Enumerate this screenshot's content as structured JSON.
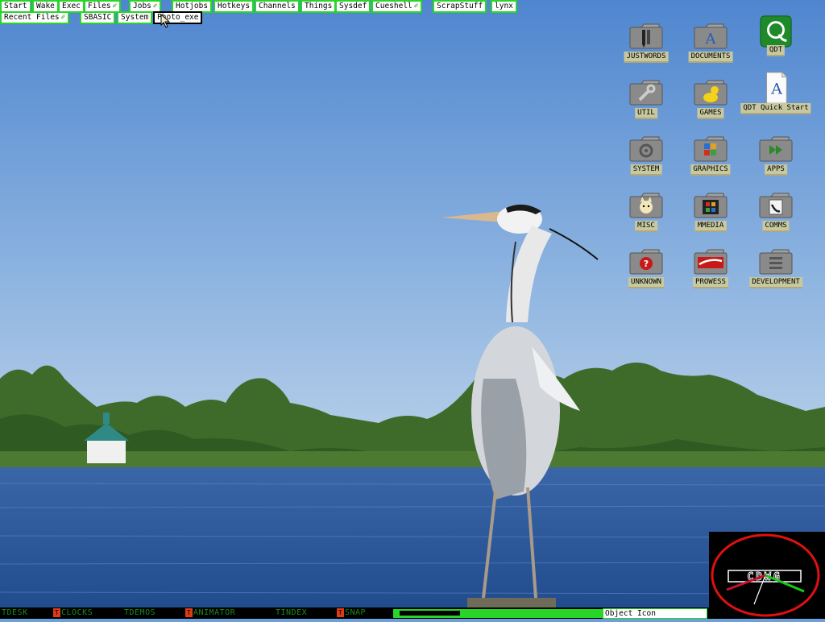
{
  "menu": {
    "row1": [
      {
        "label": "Start",
        "has_sub": false
      },
      {
        "label": "Wake",
        "has_sub": false
      },
      {
        "label": "Exec",
        "has_sub": false
      },
      {
        "label": "Files",
        "has_sub": true
      },
      {
        "label": "Jobs",
        "has_sub": true
      },
      {
        "label": "Hotjobs",
        "has_sub": false
      },
      {
        "label": "Hotkeys",
        "has_sub": false
      },
      {
        "label": "Channels",
        "has_sub": false
      },
      {
        "label": "Things",
        "has_sub": false
      },
      {
        "label": "Sysdef",
        "has_sub": false
      },
      {
        "label": "Cueshell",
        "has_sub": true
      },
      {
        "label": "ScrapStuff",
        "has_sub": false
      },
      {
        "label": "lynx",
        "has_sub": false
      }
    ],
    "row2": [
      {
        "label": "Recent Files",
        "has_sub": true
      },
      {
        "label": "SBASIC",
        "has_sub": false
      },
      {
        "label": "System",
        "has_sub": false
      },
      {
        "label": "Photo_exe",
        "has_sub": false,
        "selected": true
      }
    ],
    "sub_glyph": "✐"
  },
  "desktop_icons": [
    {
      "label": "JUSTWORDS",
      "icon": "folder-pen-icon"
    },
    {
      "label": "DOCUMENTS",
      "icon": "folder-letter-a-icon"
    },
    {
      "label": "QDT",
      "icon": "qdt-logo-icon"
    },
    {
      "label": "UTIL",
      "icon": "folder-wrench-icon"
    },
    {
      "label": "GAMES",
      "icon": "folder-duck-icon"
    },
    {
      "label": "QDT Quick Start",
      "icon": "document-a-icon"
    },
    {
      "label": "SYSTEM",
      "icon": "folder-gear-icon"
    },
    {
      "label": "GRAPHICS",
      "icon": "folder-palette-icon"
    },
    {
      "label": "APPS",
      "icon": "folder-arrows-icon"
    },
    {
      "label": "MISC",
      "icon": "folder-cat-icon"
    },
    {
      "label": "MMEDIA",
      "icon": "folder-film-icon"
    },
    {
      "label": "COMMS",
      "icon": "folder-phone-icon"
    },
    {
      "label": "UNKNOWN",
      "icon": "folder-question-icon"
    },
    {
      "label": "PROWESS",
      "icon": "folder-prowess-icon"
    },
    {
      "label": "DEVELOPMENT",
      "icon": "folder-list-icon"
    }
  ],
  "taskbar": {
    "tasks": [
      {
        "label": "TDESK",
        "marker": ""
      },
      {
        "label": "CLOCKS",
        "marker": "T"
      },
      {
        "label": "TDEMOS",
        "marker": ""
      },
      {
        "label": "ANIMATOR",
        "marker": "T"
      },
      {
        "label": "TINDEX",
        "marker": ""
      },
      {
        "label": "SNAP",
        "marker": "T"
      }
    ],
    "progress": 0.3,
    "status_text": "Object Icon"
  },
  "clock": {
    "logo_text": "CDWG"
  },
  "colors": {
    "menu_border": "#27d627",
    "task_text": "#1b8a1b",
    "task_marker": "#e03b16",
    "icon_label_bg": "#c8c8a0",
    "clock_ring": "#e01010"
  }
}
